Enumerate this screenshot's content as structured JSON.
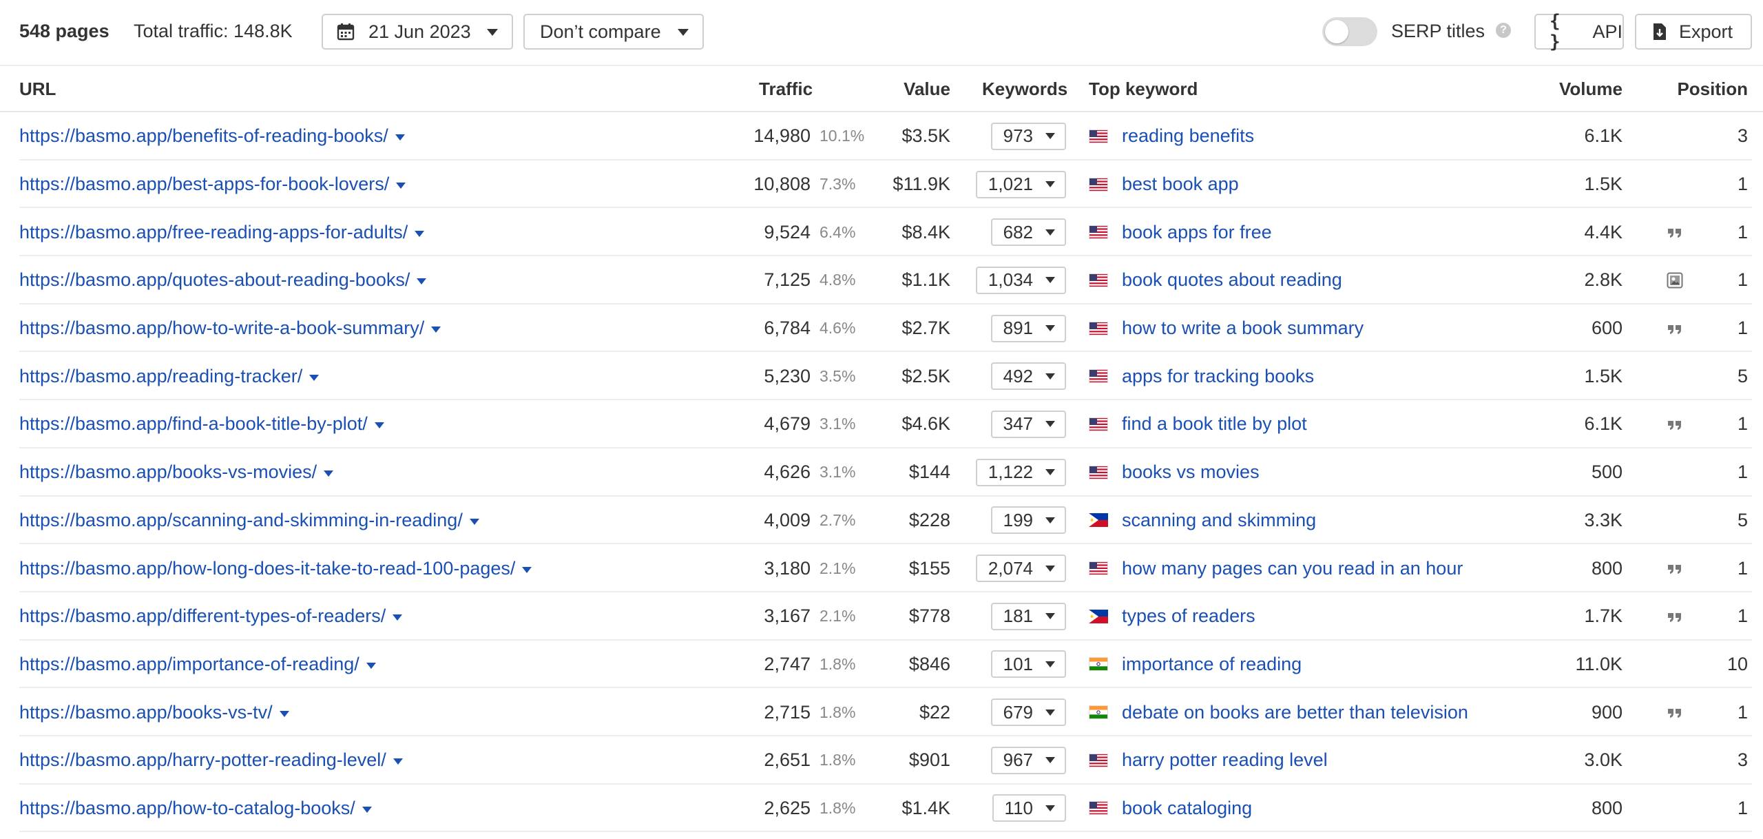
{
  "toolbar": {
    "pages_count": "548 pages",
    "total_traffic": "Total traffic: 148.8K",
    "date": "21 Jun 2023",
    "compare": "Don’t compare",
    "serp_titles_label": "SERP titles",
    "serp_titles_enabled": false,
    "help_icon": "?",
    "api_label": "API",
    "api_icon": "{ }",
    "export_label": "Export",
    "icons": {
      "date": "calendar-icon",
      "compare": "chevron-down-icon",
      "help": "help-icon",
      "api": "braces-icon",
      "export": "export-icon"
    }
  },
  "table": {
    "columns": {
      "url": "URL",
      "traffic": "Traffic",
      "value": "Value",
      "keywords": "Keywords",
      "top_keyword": "Top keyword",
      "volume": "Volume",
      "position": "Position"
    },
    "rows": [
      {
        "url": "https://basmo.app/benefits-of-reading-books/",
        "traffic": "14,980",
        "share": "10.1%",
        "value": "$3.5K",
        "keywords": "973",
        "flag": "us",
        "top_keyword": "reading benefits",
        "volume": "6.1K",
        "serp_feature": "",
        "position": "3"
      },
      {
        "url": "https://basmo.app/best-apps-for-book-lovers/",
        "traffic": "10,808",
        "share": "7.3%",
        "value": "$11.9K",
        "keywords": "1,021",
        "flag": "us",
        "top_keyword": "best book app",
        "volume": "1.5K",
        "serp_feature": "",
        "position": "1"
      },
      {
        "url": "https://basmo.app/free-reading-apps-for-adults/",
        "traffic": "9,524",
        "share": "6.4%",
        "value": "$8.4K",
        "keywords": "682",
        "flag": "us",
        "top_keyword": "book apps for free",
        "volume": "4.4K",
        "serp_feature": "quote-icon",
        "position": "1"
      },
      {
        "url": "https://basmo.app/quotes-about-reading-books/",
        "traffic": "7,125",
        "share": "4.8%",
        "value": "$1.1K",
        "keywords": "1,034",
        "flag": "us",
        "top_keyword": "book quotes about reading",
        "volume": "2.8K",
        "serp_feature": "image-pack-icon",
        "position": "1"
      },
      {
        "url": "https://basmo.app/how-to-write-a-book-summary/",
        "traffic": "6,784",
        "share": "4.6%",
        "value": "$2.7K",
        "keywords": "891",
        "flag": "us",
        "top_keyword": "how to write a book summary",
        "volume": "600",
        "serp_feature": "quote-icon",
        "position": "1"
      },
      {
        "url": "https://basmo.app/reading-tracker/",
        "traffic": "5,230",
        "share": "3.5%",
        "value": "$2.5K",
        "keywords": "492",
        "flag": "us",
        "top_keyword": "apps for tracking books",
        "volume": "1.5K",
        "serp_feature": "",
        "position": "5"
      },
      {
        "url": "https://basmo.app/find-a-book-title-by-plot/",
        "traffic": "4,679",
        "share": "3.1%",
        "value": "$4.6K",
        "keywords": "347",
        "flag": "us",
        "top_keyword": "find a book title by plot",
        "volume": "6.1K",
        "serp_feature": "quote-icon",
        "position": "1"
      },
      {
        "url": "https://basmo.app/books-vs-movies/",
        "traffic": "4,626",
        "share": "3.1%",
        "value": "$144",
        "keywords": "1,122",
        "flag": "us",
        "top_keyword": "books vs movies",
        "volume": "500",
        "serp_feature": "",
        "position": "1"
      },
      {
        "url": "https://basmo.app/scanning-and-skimming-in-reading/",
        "traffic": "4,009",
        "share": "2.7%",
        "value": "$228",
        "keywords": "199",
        "flag": "ph",
        "top_keyword": "scanning and skimming",
        "volume": "3.3K",
        "serp_feature": "",
        "position": "5"
      },
      {
        "url": "https://basmo.app/how-long-does-it-take-to-read-100-pages/",
        "traffic": "3,180",
        "share": "2.1%",
        "value": "$155",
        "keywords": "2,074",
        "flag": "us",
        "top_keyword": "how many pages can you read in an hour",
        "volume": "800",
        "serp_feature": "quote-icon",
        "position": "1"
      },
      {
        "url": "https://basmo.app/different-types-of-readers/",
        "traffic": "3,167",
        "share": "2.1%",
        "value": "$778",
        "keywords": "181",
        "flag": "ph",
        "top_keyword": "types of readers",
        "volume": "1.7K",
        "serp_feature": "quote-icon",
        "position": "1"
      },
      {
        "url": "https://basmo.app/importance-of-reading/",
        "traffic": "2,747",
        "share": "1.8%",
        "value": "$846",
        "keywords": "101",
        "flag": "in",
        "top_keyword": "importance of reading",
        "volume": "11.0K",
        "serp_feature": "",
        "position": "10"
      },
      {
        "url": "https://basmo.app/books-vs-tv/",
        "traffic": "2,715",
        "share": "1.8%",
        "value": "$22",
        "keywords": "679",
        "flag": "in",
        "top_keyword": "debate on books are better than television",
        "volume": "900",
        "serp_feature": "quote-icon",
        "position": "1"
      },
      {
        "url": "https://basmo.app/harry-potter-reading-level/",
        "traffic": "2,651",
        "share": "1.8%",
        "value": "$901",
        "keywords": "967",
        "flag": "us",
        "top_keyword": "harry potter reading level",
        "volume": "3.0K",
        "serp_feature": "",
        "position": "3"
      },
      {
        "url": "https://basmo.app/how-to-catalog-books/",
        "traffic": "2,625",
        "share": "1.8%",
        "value": "$1.4K",
        "keywords": "110",
        "flag": "us",
        "top_keyword": "book cataloging",
        "volume": "800",
        "serp_feature": "",
        "position": "1"
      }
    ]
  },
  "colors": {
    "link": "#1a4fb4",
    "text": "#333333",
    "muted": "#888888",
    "border": "#cfcfcf"
  }
}
